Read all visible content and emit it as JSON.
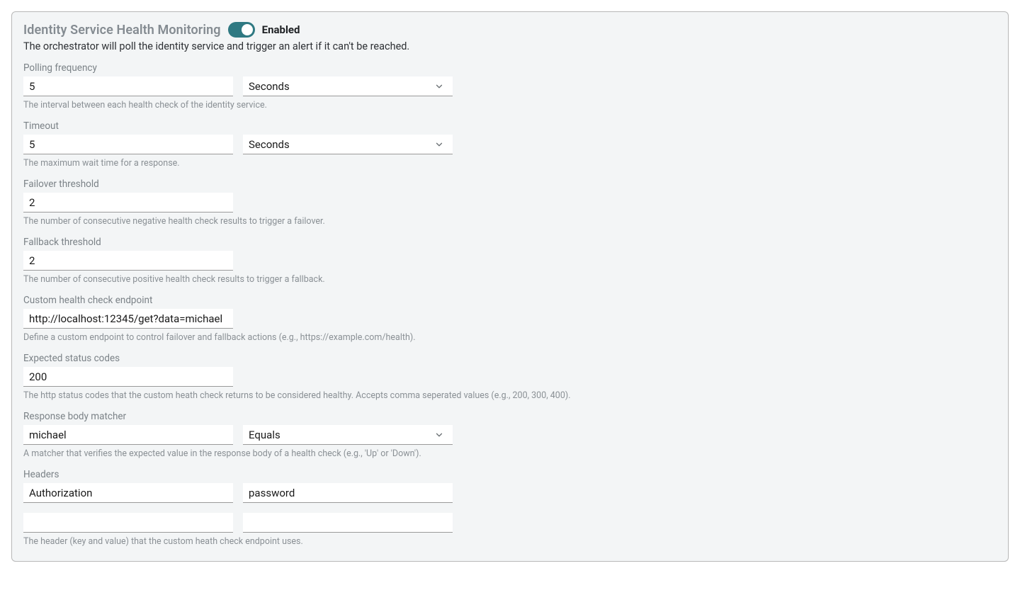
{
  "section": {
    "title": "Identity Service Health Monitoring",
    "toggle_state_label": "Enabled",
    "description": "The orchestrator will poll the identity service and trigger an alert if it can't be reached."
  },
  "polling": {
    "label": "Polling frequency",
    "value": "5",
    "unit_selected": "Seconds",
    "help": "The interval between each health check of the identity service."
  },
  "timeout": {
    "label": "Timeout",
    "value": "5",
    "unit_selected": "Seconds",
    "help": "The maximum wait time for a response."
  },
  "failover": {
    "label": "Failover threshold",
    "value": "2",
    "help": "The number of consecutive negative health check results to trigger a failover."
  },
  "fallback": {
    "label": "Fallback threshold",
    "value": "2",
    "help": "The number of consecutive positive health check results to trigger a fallback."
  },
  "endpoint": {
    "label": "Custom health check endpoint",
    "value": "http://localhost:12345/get?data=michael",
    "help": "Define a custom endpoint to control failover and fallback actions (e.g., https://example.com/health)."
  },
  "status_codes": {
    "label": "Expected status codes",
    "value": "200",
    "help": "The http status codes that the custom heath check returns to be considered healthy. Accepts comma seperated values (e.g., 200, 300, 400)."
  },
  "matcher": {
    "label": "Response body matcher",
    "value": "michael",
    "op_selected": "Equals",
    "help": "A matcher that verifies the expected value in the response body of a health check (e.g., 'Up' or 'Down')."
  },
  "headers": {
    "label": "Headers",
    "rows": [
      {
        "key": "Authorization",
        "value": "password"
      },
      {
        "key": "",
        "value": ""
      }
    ],
    "help": "The header (key and value) that the custom heath check endpoint uses."
  }
}
